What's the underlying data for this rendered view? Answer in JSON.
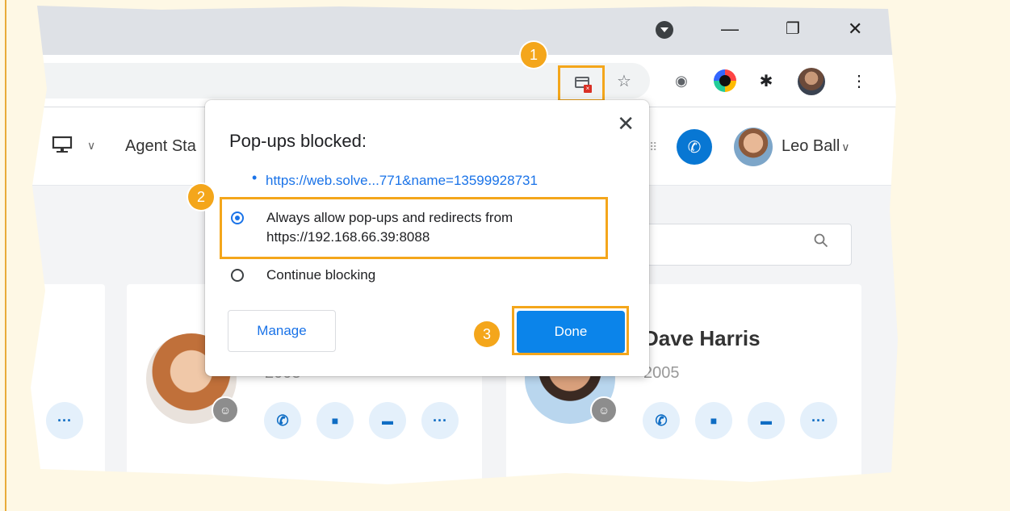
{
  "window": {
    "minimize_glyph": "—",
    "restore_glyph": "❐",
    "close_glyph": "✕"
  },
  "toolbar": {
    "icons": [
      "popup-blocked-icon",
      "star-icon",
      "camera-icon",
      "color-extension-icon",
      "puzzle-icon",
      "profile-avatar",
      "more-icon"
    ],
    "star_glyph": "☆",
    "camera_glyph": "◉",
    "puzzle_glyph": "✱",
    "more_glyph": "⋮"
  },
  "app": {
    "agent_label": "Agent Sta",
    "chevron": "∨",
    "dial_glyph": "⠿",
    "call_glyph": "✆",
    "user_name": "Leo Ball",
    "user_chevron": "∨",
    "search_glyph": "⚲"
  },
  "contacts": [
    {
      "name": "",
      "ext": "2003"
    },
    {
      "name": "Dave Harris",
      "ext": "2005"
    }
  ],
  "actions": {
    "call": "✆",
    "video": "■",
    "message": "▬",
    "more": "···"
  },
  "badge_glyph": "☺",
  "dialog": {
    "title": "Pop-ups blocked:",
    "close_glyph": "✕",
    "bullet": "•",
    "link": "https://web.solve...771&name=13599928731",
    "option_allow_line1": "Always allow pop-ups and redirects from",
    "option_allow_line2": "https://192.168.66.39:8088",
    "option_block": "Continue blocking",
    "selected_option": "allow",
    "manage_label": "Manage",
    "done_label": "Done"
  },
  "steps": [
    "1",
    "2",
    "3"
  ],
  "colors": {
    "accent": "#f4a61b",
    "primary": "#0b84ea",
    "link": "#1a73e8"
  }
}
